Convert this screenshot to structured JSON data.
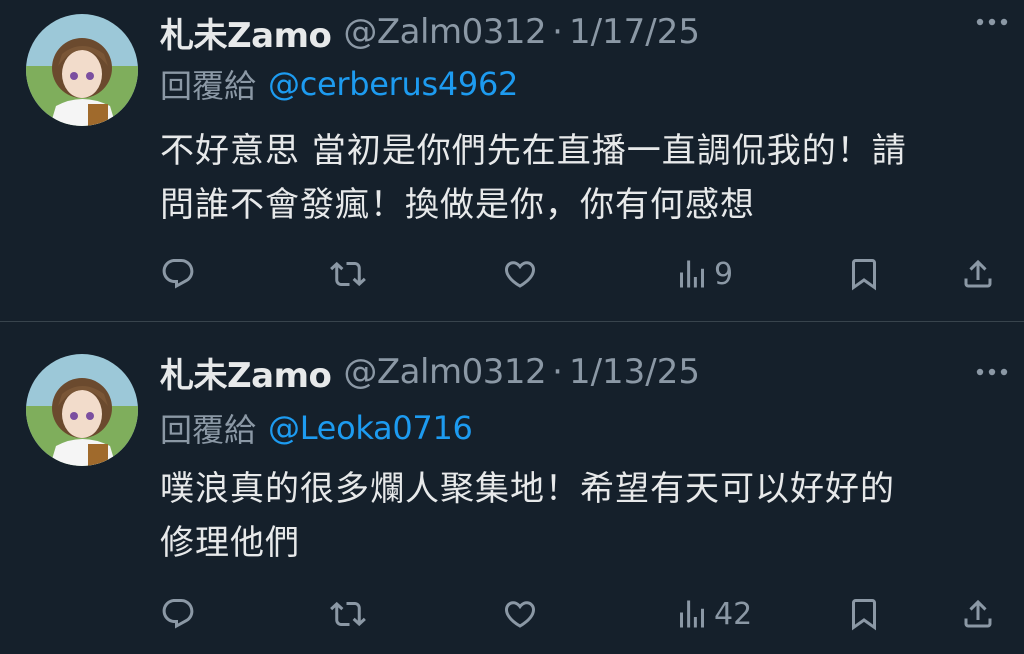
{
  "tweets": [
    {
      "display_name": "札未Zamo",
      "handle": "@Zalm0312",
      "separator": "·",
      "date": "1/17/25",
      "reply_prefix": "回覆給",
      "reply_to": "@cerberus4962",
      "text_lines": [
        "不好意思 當初是你們先在直播一直調侃我的！請",
        "問誰不會發瘋！換做是你，你有何感想"
      ],
      "views": "9"
    },
    {
      "display_name": "札未Zamo",
      "handle": "@Zalm0312",
      "separator": "·",
      "date": "1/13/25",
      "reply_prefix": "回覆給",
      "reply_to": "@Leoka0716",
      "text_lines": [
        "噗浪真的很多爛人聚集地！希望有天可以好好的",
        "修理他們"
      ],
      "views": "42"
    }
  ],
  "icons": {
    "more": "more-horizontal-icon",
    "reply": "reply-icon",
    "retweet": "retweet-icon",
    "like": "heart-icon",
    "views": "views-bar-chart-icon",
    "bookmark": "bookmark-icon",
    "share": "share-upload-icon"
  },
  "colors": {
    "background": "#15202b",
    "text_primary": "#e7e9ea",
    "text_secondary": "#8b98a5",
    "accent_link": "#1d9bf0",
    "divider": "#38444d"
  }
}
